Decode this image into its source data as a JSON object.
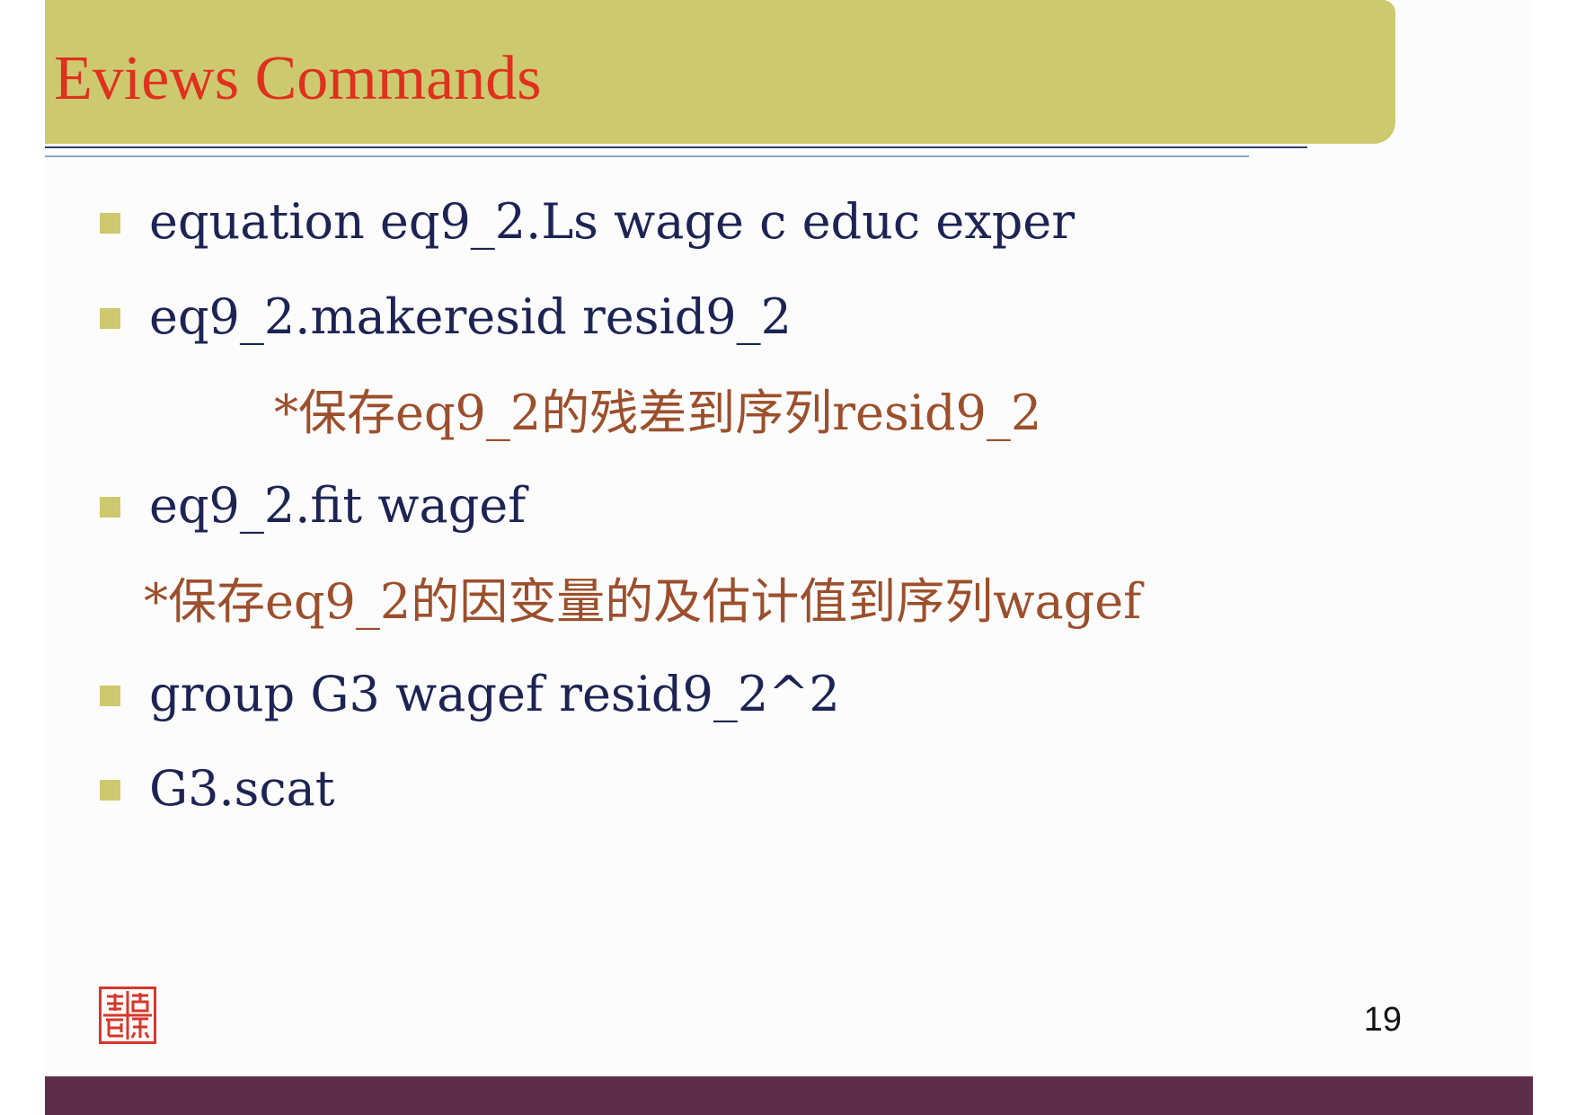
{
  "slide": {
    "title": "Eviews Commands",
    "commands": [
      {
        "text": "equation eq9_2.Ls wage c educ exper"
      },
      {
        "text": "eq9_2.makeresid resid9_2"
      },
      {
        "text": "eq9_2.fit wagef"
      },
      {
        "text": "group G3 wagef resid9_2^2"
      },
      {
        "text": "G3.scat"
      }
    ],
    "notes": [
      "*保存eq9_2的残差到序列resid9_2",
      "*保存eq9_2的因变量的及估计值到序列wagef"
    ],
    "page_number": "19",
    "seal_icon": "red-seal-stamp-icon"
  },
  "colors": {
    "title_bar": "#cdc96e",
    "title_text": "#e0301e",
    "body_text": "#1c2454",
    "note_text": "#9c4f2c",
    "bullet": "#cdc96e",
    "footer_bar": "#5c2e47",
    "seal": "#d8362a"
  }
}
